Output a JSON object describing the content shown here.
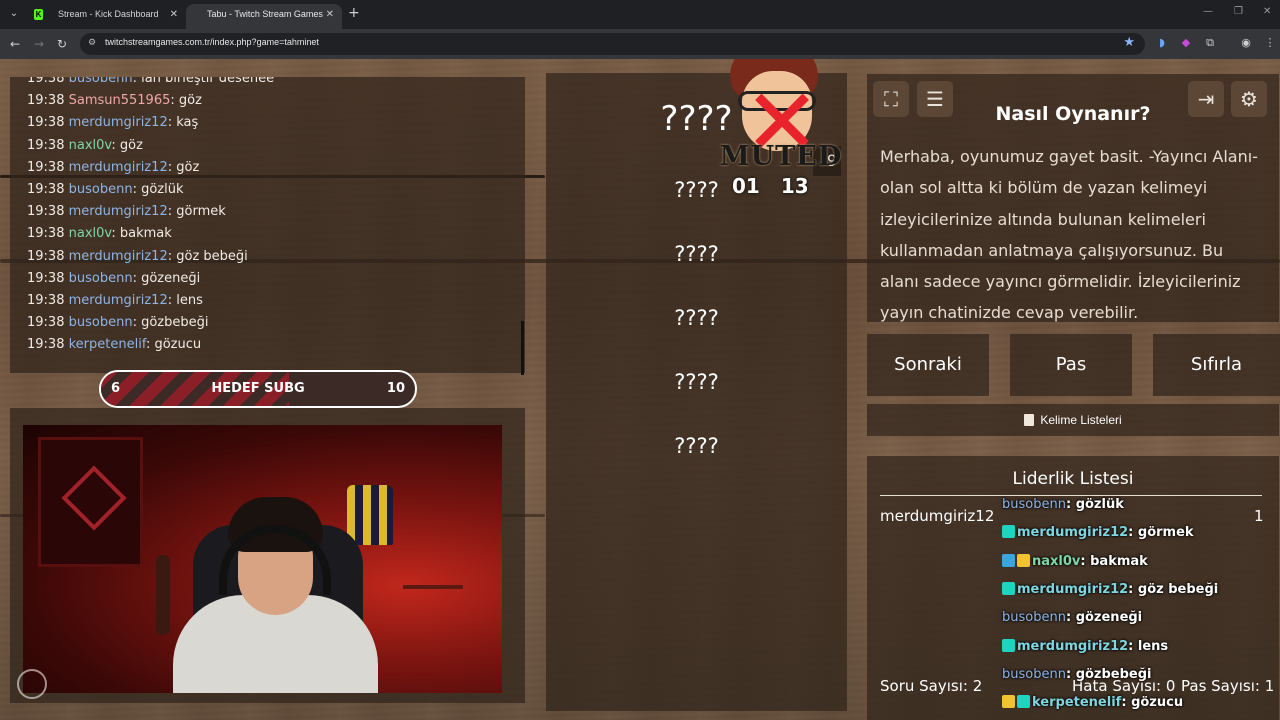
{
  "browser": {
    "tabs": [
      {
        "title": "Stream - Kick Dashboard",
        "favicon": "K"
      },
      {
        "title": "Tabu - Twitch Stream Games"
      }
    ],
    "url": "twitchstreamgames.com.tr/index.php?game=tahminet"
  },
  "chat": {
    "lines": [
      {
        "time": "19:38",
        "user": "busobenn",
        "color": "blue",
        "msg": "lan birleştir desenee"
      },
      {
        "time": "19:38",
        "user": "Samsun551965",
        "color": "pink",
        "msg": "göz"
      },
      {
        "time": "19:38",
        "user": "merdumgiriz12",
        "color": "blue",
        "msg": "kaş"
      },
      {
        "time": "19:38",
        "user": "naxl0v",
        "color": "green",
        "msg": "göz"
      },
      {
        "time": "19:38",
        "user": "merdumgiriz12",
        "color": "blue",
        "msg": "göz"
      },
      {
        "time": "19:38",
        "user": "busobenn",
        "color": "blue",
        "msg": "gözlük"
      },
      {
        "time": "19:38",
        "user": "merdumgiriz12",
        "color": "blue",
        "msg": "görmek"
      },
      {
        "time": "19:38",
        "user": "naxl0v",
        "color": "green",
        "msg": "bakmak"
      },
      {
        "time": "19:38",
        "user": "merdumgiriz12",
        "color": "blue",
        "msg": "göz bebeği"
      },
      {
        "time": "19:38",
        "user": "busobenn",
        "color": "blue",
        "msg": "gözeneği"
      },
      {
        "time": "19:38",
        "user": "merdumgiriz12",
        "color": "blue",
        "msg": "lens"
      },
      {
        "time": "19:38",
        "user": "busobenn",
        "color": "blue",
        "msg": "gözbebeği"
      },
      {
        "time": "19:38",
        "user": "kerpetenelif",
        "color": "blue",
        "msg": "gözucu"
      }
    ]
  },
  "goal": {
    "current": "6",
    "label": "HEDEF SUBG",
    "target": "10",
    "progress": 0.6
  },
  "game": {
    "main_word": "????",
    "banned_words": [
      "????",
      "????",
      "????",
      "????",
      "????"
    ],
    "badge": "9",
    "muted_label": "MUTED",
    "timer_min": "01",
    "timer_sec": "13"
  },
  "howto": {
    "title": "Nasıl Oynanır?",
    "text": "Merhaba, oyunumuz gayet basit. -Yayıncı Alanı- olan sol altta ki bölüm de yazan kelimeyi izleyicilerinize altında bulunan kelimeleri kullanmadan anlatmaya çalışıyorsunuz. Bu alanı sadece yayıncı görmelidir. İzleyicileriniz yayın chatinizde cevap verebilir."
  },
  "actions": {
    "next": "Sonraki",
    "pass": "Pas",
    "reset": "Sıfırla",
    "lists": "Kelime Listeleri"
  },
  "leaderboard": {
    "title": "Liderlik Listesi",
    "rows": [
      {
        "name": "merdumgiriz12",
        "score": "1"
      }
    ],
    "question_count_label": "Soru Sayısı:",
    "question_count": "2",
    "error_count_label": "Hata Sayısı:",
    "error_count": "0",
    "pass_count_label": "Pas Sayısı:",
    "pass_count": "1"
  },
  "overlay_chat": [
    {
      "user": "busobenn",
      "msg": "gözlük",
      "badge": "none"
    },
    {
      "user": "merdumgiriz12",
      "msg": "görmek",
      "badge": "sub"
    },
    {
      "user": "naxl0v",
      "msg": "bakmak",
      "badge": "vip"
    },
    {
      "user": "merdumgiriz12",
      "msg": "göz bebeği",
      "badge": "sub"
    },
    {
      "user": "busobenn",
      "msg": "gözeneği",
      "badge": "none"
    },
    {
      "user": "merdumgiriz12",
      "msg": "lens",
      "badge": "sub"
    },
    {
      "user": "busobenn",
      "msg": "gözbebeği",
      "badge": "none"
    },
    {
      "user": "kerpetenelif",
      "msg": "gözucu",
      "badge": "gift"
    }
  ]
}
